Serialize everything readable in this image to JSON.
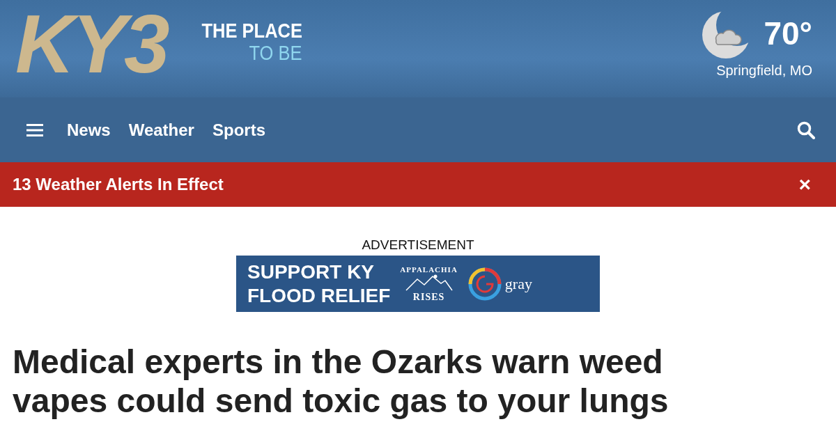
{
  "header": {
    "logo": "KY3",
    "tagline_top": "THE PLACE",
    "tagline_bottom": "TO BE",
    "weather": {
      "temperature": "70°",
      "location": "Springfield, MO"
    }
  },
  "nav": {
    "items": [
      {
        "label": "News"
      },
      {
        "label": "Weather"
      },
      {
        "label": "Sports"
      }
    ]
  },
  "alert_bar": {
    "text": "13 Weather Alerts In Effect",
    "close": "×"
  },
  "advertisement": {
    "label": "ADVERTISEMENT",
    "headline_line1": "SUPPORT KY",
    "headline_line2": "FLOOD RELIEF",
    "badge_top": "APPALACHIA",
    "badge_bottom": "RISES",
    "brand": "gray"
  },
  "article": {
    "headline": "Medical experts in the Ozarks warn weed vapes could send toxic gas to your lungs"
  }
}
